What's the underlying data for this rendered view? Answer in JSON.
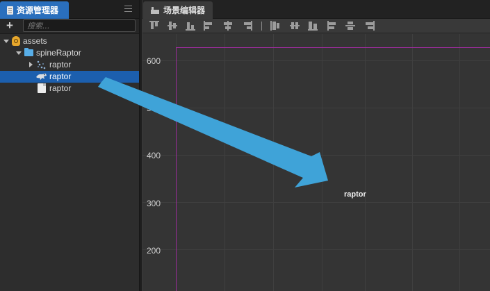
{
  "assets_panel": {
    "tab_title": "资源管理器",
    "add_label": "+",
    "search_placeholder": "搜索...",
    "tree": {
      "root_label": "assets",
      "folder_label": "spineRaptor",
      "items": [
        {
          "label": "raptor",
          "icon": "spine-dots-icon",
          "expandable": true,
          "selected": false
        },
        {
          "label": "raptor",
          "icon": "raptor-skeleton-icon",
          "expandable": false,
          "selected": true
        },
        {
          "label": "raptor",
          "icon": "file-icon",
          "expandable": false,
          "selected": false
        }
      ]
    }
  },
  "scene_panel": {
    "tab_title": "场景编辑器",
    "toolbar_icons": [
      "align-top-icon",
      "align-vertical-center-icon",
      "align-bottom-icon",
      "align-left-icon",
      "align-horizontal-center-icon",
      "align-right-icon",
      "distribute-top-icon",
      "distribute-vertical-center-icon",
      "distribute-bottom-icon",
      "distribute-left-icon",
      "distribute-horizontal-center-icon",
      "distribute-right-icon"
    ],
    "y_axis_labels": [
      "600",
      "500",
      "400",
      "300",
      "200"
    ],
    "node_label": "raptor"
  },
  "colors": {
    "selection": "#1c5fae",
    "active_tab": "#2a6fbd",
    "design_resolution_border": "#9a2c9a",
    "annotation_arrow": "#3fa3d8"
  }
}
